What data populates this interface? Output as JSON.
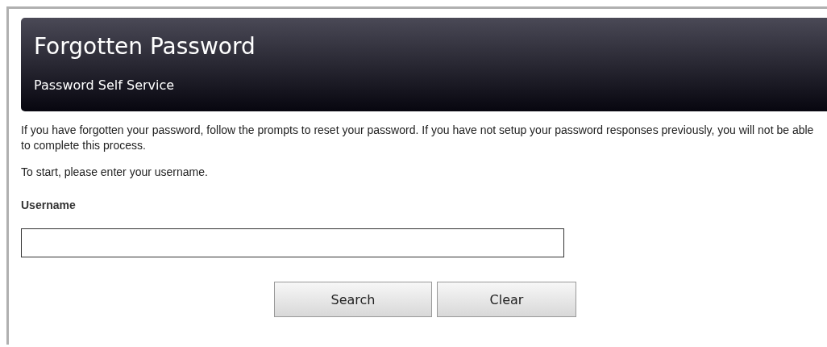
{
  "header": {
    "title": "Forgotten Password",
    "subtitle": "Password Self Service"
  },
  "intro": "If you have forgotten your password, follow the prompts to reset your password. If you have not setup your password responses previously, you will not be able to complete this process.",
  "instruction": "To start, please enter your username.",
  "username_field": {
    "label": "Username"
  },
  "buttons": [
    "Search",
    "Clear"
  ]
}
